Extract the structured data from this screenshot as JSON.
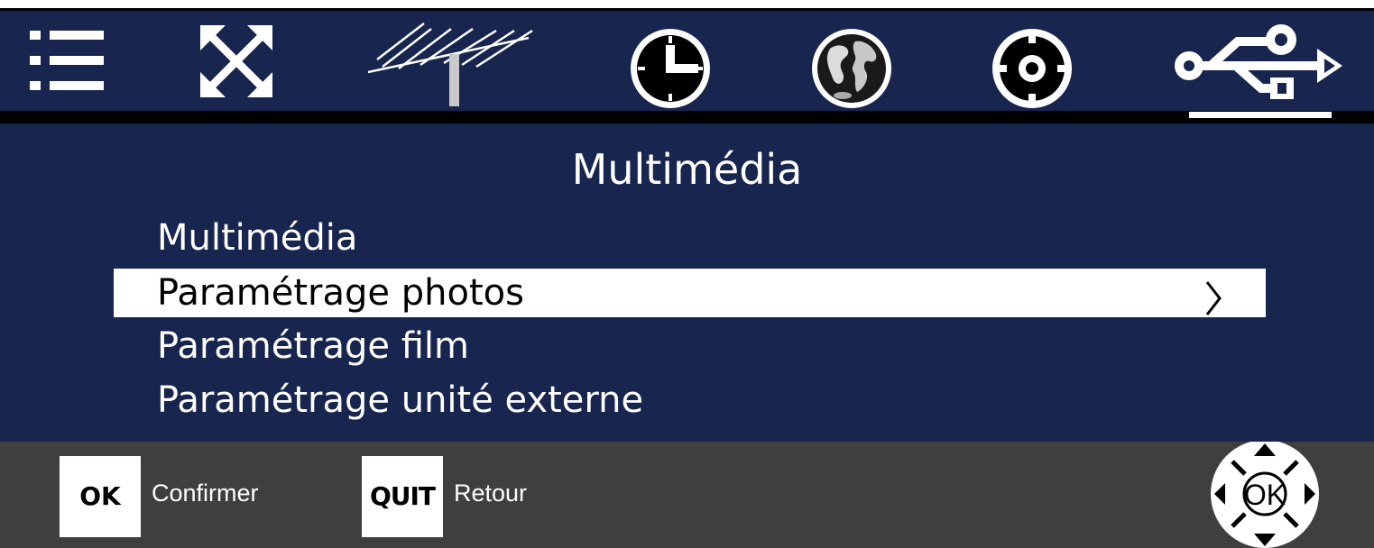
{
  "topbar": {
    "icons": [
      {
        "name": "list-menu-icon"
      },
      {
        "name": "expand-arrows-icon"
      },
      {
        "name": "antenna-icon"
      },
      {
        "name": "clock-icon"
      },
      {
        "name": "globe-icon"
      },
      {
        "name": "gear-icon"
      },
      {
        "name": "usb-icon",
        "active": true
      }
    ]
  },
  "content": {
    "title": "Multimédia",
    "items": [
      {
        "label": "Multimédia",
        "selected": false
      },
      {
        "label": "Paramétrage photos",
        "selected": true
      },
      {
        "label": "Paramétrage film",
        "selected": false
      },
      {
        "label": "Paramétrage unité externe",
        "selected": false
      }
    ]
  },
  "footer": {
    "ok_key": "OK",
    "ok_label": "Confirmer",
    "quit_key": "QUIT",
    "quit_label": "Retour",
    "dpad_center": "OK"
  },
  "colors": {
    "panel": "#17254f",
    "footer": "#3f3f3f",
    "text": "#ffffff"
  }
}
